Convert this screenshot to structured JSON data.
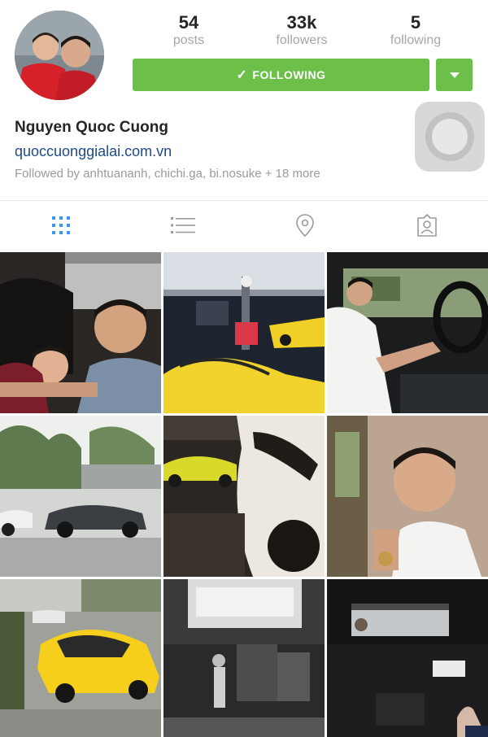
{
  "profile": {
    "name": "Nguyen Quoc Cuong",
    "website": "quoccuonggialai.com.vn",
    "followed_by": "Followed by anhtuananh, chichi.ga, bi.nosuke + 18 more"
  },
  "stats": {
    "posts": {
      "value": "54",
      "label": "posts"
    },
    "followers": {
      "value": "33k",
      "label": "followers"
    },
    "following": {
      "value": "5",
      "label": "following"
    }
  },
  "actions": {
    "follow_label": "FOLLOWING"
  },
  "tabs": [
    {
      "name": "grid-view",
      "icon": "grid-icon",
      "active": true
    },
    {
      "name": "list-view",
      "icon": "list-icon",
      "active": false
    },
    {
      "name": "map-view",
      "icon": "location-pin-icon",
      "active": false
    },
    {
      "name": "tagged-view",
      "icon": "tagged-person-icon",
      "active": false
    }
  ],
  "colors": {
    "follow_green": "#6cc04a",
    "active_tab_blue": "#3897f0",
    "inactive_tab_gray": "#9b9b9b",
    "link_blue": "#1e4a8a"
  },
  "photos": [
    "man and boy on leather seat",
    "garage with yellow supercar",
    "man driving car",
    "supercars on wet street",
    "yellow and white supercars in garage",
    "man leaning on hand",
    "yellow supercar on street",
    "black and white interior room",
    "car interior view"
  ]
}
